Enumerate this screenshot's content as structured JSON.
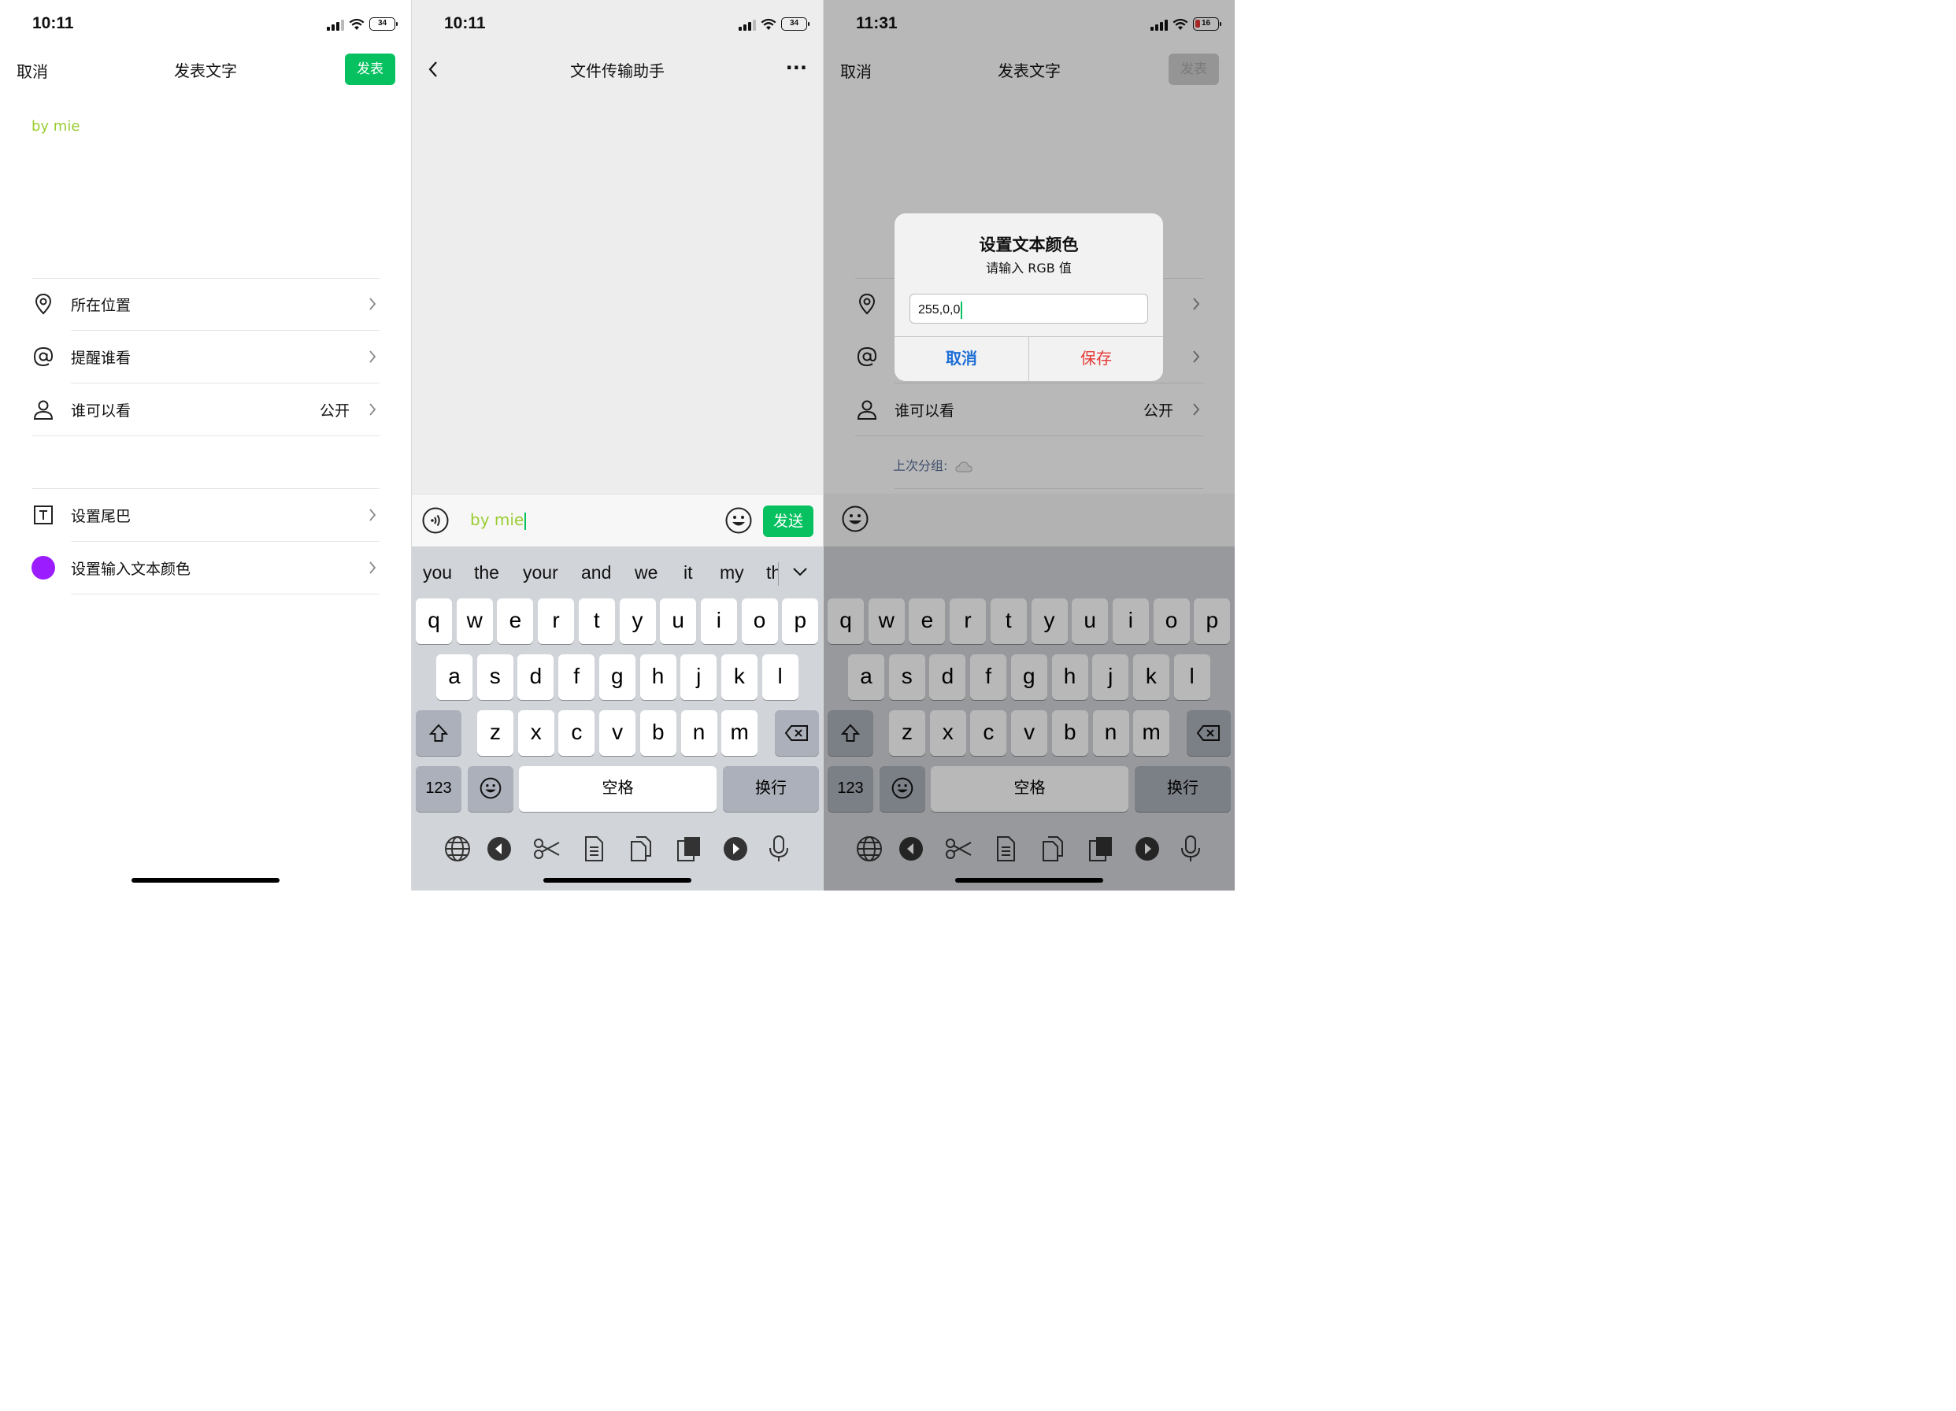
{
  "panel1": {
    "status": {
      "time": "10:11",
      "battery": "34"
    },
    "nav": {
      "cancel": "取消",
      "title": "发表文字",
      "publish": "发表"
    },
    "post_text": "by mie",
    "rows": [
      {
        "label": "所在位置",
        "icon": "location-pin-icon",
        "value": ""
      },
      {
        "label": "提醒谁看",
        "icon": "at-icon",
        "value": ""
      },
      {
        "label": "谁可以看",
        "icon": "person-icon",
        "value": "公开"
      },
      {
        "label": "设置尾巴",
        "icon": "text-box-icon",
        "value": ""
      },
      {
        "label": "设置输入文本颜色",
        "icon": "purple-dot-icon",
        "value": ""
      }
    ],
    "color_dot": "#9b1dff"
  },
  "panel2": {
    "status": {
      "time": "10:11",
      "battery": "34"
    },
    "nav": {
      "title": "文件传输助手",
      "more": "···"
    },
    "input_text": "by mie",
    "send": "发送"
  },
  "panel3": {
    "status": {
      "time": "11:31",
      "battery": "16"
    },
    "nav": {
      "cancel": "取消",
      "title": "发表文字",
      "publish": "发表"
    },
    "row_visibility": {
      "label": "谁可以看",
      "value": "公开"
    },
    "last_group": "上次分组:",
    "dialog": {
      "title": "设置文本颜色",
      "subtitle": "请输入 RGB 值",
      "input_value": "255,0,0",
      "cancel": "取消",
      "save": "保存"
    }
  },
  "keyboard": {
    "suggestions": [
      "you",
      "the",
      "your",
      "and",
      "we",
      "it",
      "my",
      "th"
    ],
    "row1": [
      "q",
      "w",
      "e",
      "r",
      "t",
      "y",
      "u",
      "i",
      "o",
      "p"
    ],
    "row2": [
      "a",
      "s",
      "d",
      "f",
      "g",
      "h",
      "j",
      "k",
      "l"
    ],
    "row3": [
      "z",
      "x",
      "c",
      "v",
      "b",
      "n",
      "m"
    ],
    "numbers": "123",
    "space": "空格",
    "return": "换行"
  },
  "colors": {
    "wechat_green": "#07c160",
    "text_green": "#9acd32",
    "danger_red": "#e53935",
    "dialog_blue": "#1f6fd6"
  }
}
